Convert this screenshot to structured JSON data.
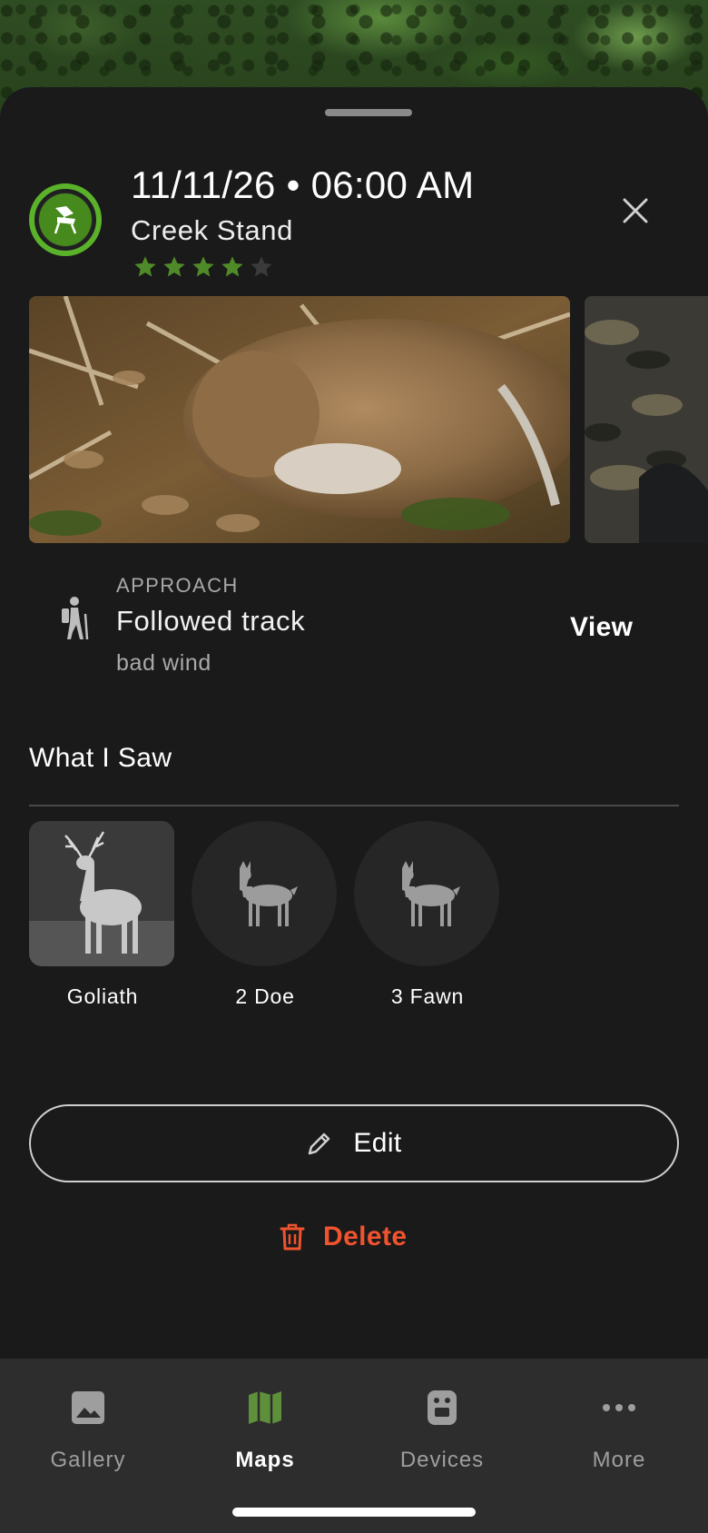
{
  "background": {
    "kind": "satellite-map"
  },
  "header": {
    "datetime": "11/11/26 • 06:00 AM",
    "location": "Creek Stand",
    "rating": 4,
    "rating_max": 5,
    "avatar_icon": "tree-stand-icon",
    "close_icon": "close-icon"
  },
  "photos": [
    {
      "name": "photo-deer-harvest"
    },
    {
      "name": "photo-hunter-camo"
    }
  ],
  "approach": {
    "label": "APPROACH",
    "value": "Followed track",
    "note": "bad wind",
    "action": "View",
    "icon": "hiker-icon"
  },
  "what_i_saw": {
    "title": "What I Saw",
    "items": [
      {
        "label": "Goliath",
        "kind": "photo"
      },
      {
        "label": "2 Doe",
        "kind": "doe-icon"
      },
      {
        "label": "3 Fawn",
        "kind": "doe-icon"
      }
    ]
  },
  "actions": {
    "edit_label": "Edit",
    "delete_label": "Delete"
  },
  "nav": {
    "items": [
      {
        "label": "Gallery",
        "icon": "image-icon",
        "active": false
      },
      {
        "label": "Maps",
        "icon": "map-icon",
        "active": true
      },
      {
        "label": "Devices",
        "icon": "camera-device-icon",
        "active": false
      },
      {
        "label": "More",
        "icon": "more-dots-icon",
        "active": false
      }
    ]
  },
  "colors": {
    "accent_green": "#5ab22a",
    "star_green": "#4f8a28",
    "delete_red": "#f0532e",
    "background": "#1a1a1a"
  }
}
